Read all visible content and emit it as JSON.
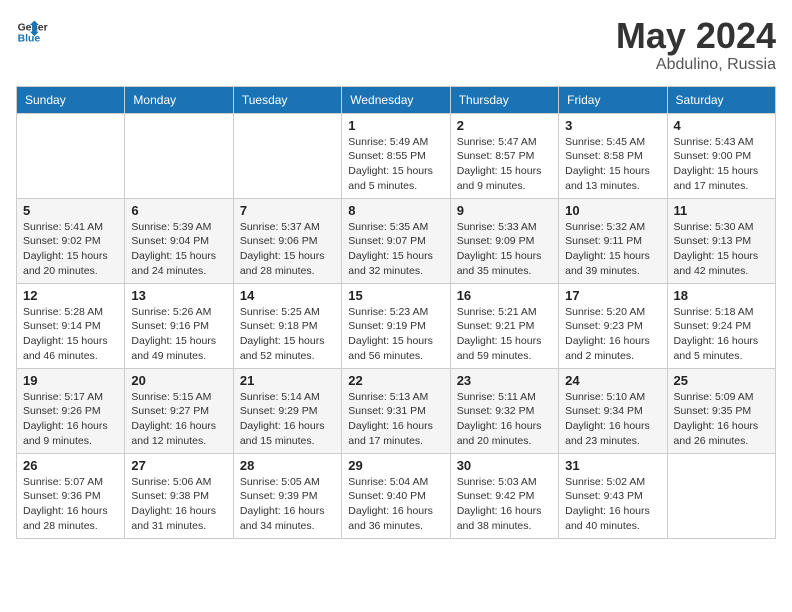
{
  "header": {
    "logo_line1": "General",
    "logo_line2": "Blue",
    "title": "May 2024",
    "location": "Abdulino, Russia"
  },
  "weekdays": [
    "Sunday",
    "Monday",
    "Tuesday",
    "Wednesday",
    "Thursday",
    "Friday",
    "Saturday"
  ],
  "weeks": [
    [
      {
        "day": "",
        "info": ""
      },
      {
        "day": "",
        "info": ""
      },
      {
        "day": "",
        "info": ""
      },
      {
        "day": "1",
        "info": "Sunrise: 5:49 AM\nSunset: 8:55 PM\nDaylight: 15 hours\nand 5 minutes."
      },
      {
        "day": "2",
        "info": "Sunrise: 5:47 AM\nSunset: 8:57 PM\nDaylight: 15 hours\nand 9 minutes."
      },
      {
        "day": "3",
        "info": "Sunrise: 5:45 AM\nSunset: 8:58 PM\nDaylight: 15 hours\nand 13 minutes."
      },
      {
        "day": "4",
        "info": "Sunrise: 5:43 AM\nSunset: 9:00 PM\nDaylight: 15 hours\nand 17 minutes."
      }
    ],
    [
      {
        "day": "5",
        "info": "Sunrise: 5:41 AM\nSunset: 9:02 PM\nDaylight: 15 hours\nand 20 minutes."
      },
      {
        "day": "6",
        "info": "Sunrise: 5:39 AM\nSunset: 9:04 PM\nDaylight: 15 hours\nand 24 minutes."
      },
      {
        "day": "7",
        "info": "Sunrise: 5:37 AM\nSunset: 9:06 PM\nDaylight: 15 hours\nand 28 minutes."
      },
      {
        "day": "8",
        "info": "Sunrise: 5:35 AM\nSunset: 9:07 PM\nDaylight: 15 hours\nand 32 minutes."
      },
      {
        "day": "9",
        "info": "Sunrise: 5:33 AM\nSunset: 9:09 PM\nDaylight: 15 hours\nand 35 minutes."
      },
      {
        "day": "10",
        "info": "Sunrise: 5:32 AM\nSunset: 9:11 PM\nDaylight: 15 hours\nand 39 minutes."
      },
      {
        "day": "11",
        "info": "Sunrise: 5:30 AM\nSunset: 9:13 PM\nDaylight: 15 hours\nand 42 minutes."
      }
    ],
    [
      {
        "day": "12",
        "info": "Sunrise: 5:28 AM\nSunset: 9:14 PM\nDaylight: 15 hours\nand 46 minutes."
      },
      {
        "day": "13",
        "info": "Sunrise: 5:26 AM\nSunset: 9:16 PM\nDaylight: 15 hours\nand 49 minutes."
      },
      {
        "day": "14",
        "info": "Sunrise: 5:25 AM\nSunset: 9:18 PM\nDaylight: 15 hours\nand 52 minutes."
      },
      {
        "day": "15",
        "info": "Sunrise: 5:23 AM\nSunset: 9:19 PM\nDaylight: 15 hours\nand 56 minutes."
      },
      {
        "day": "16",
        "info": "Sunrise: 5:21 AM\nSunset: 9:21 PM\nDaylight: 15 hours\nand 59 minutes."
      },
      {
        "day": "17",
        "info": "Sunrise: 5:20 AM\nSunset: 9:23 PM\nDaylight: 16 hours\nand 2 minutes."
      },
      {
        "day": "18",
        "info": "Sunrise: 5:18 AM\nSunset: 9:24 PM\nDaylight: 16 hours\nand 5 minutes."
      }
    ],
    [
      {
        "day": "19",
        "info": "Sunrise: 5:17 AM\nSunset: 9:26 PM\nDaylight: 16 hours\nand 9 minutes."
      },
      {
        "day": "20",
        "info": "Sunrise: 5:15 AM\nSunset: 9:27 PM\nDaylight: 16 hours\nand 12 minutes."
      },
      {
        "day": "21",
        "info": "Sunrise: 5:14 AM\nSunset: 9:29 PM\nDaylight: 16 hours\nand 15 minutes."
      },
      {
        "day": "22",
        "info": "Sunrise: 5:13 AM\nSunset: 9:31 PM\nDaylight: 16 hours\nand 17 minutes."
      },
      {
        "day": "23",
        "info": "Sunrise: 5:11 AM\nSunset: 9:32 PM\nDaylight: 16 hours\nand 20 minutes."
      },
      {
        "day": "24",
        "info": "Sunrise: 5:10 AM\nSunset: 9:34 PM\nDaylight: 16 hours\nand 23 minutes."
      },
      {
        "day": "25",
        "info": "Sunrise: 5:09 AM\nSunset: 9:35 PM\nDaylight: 16 hours\nand 26 minutes."
      }
    ],
    [
      {
        "day": "26",
        "info": "Sunrise: 5:07 AM\nSunset: 9:36 PM\nDaylight: 16 hours\nand 28 minutes."
      },
      {
        "day": "27",
        "info": "Sunrise: 5:06 AM\nSunset: 9:38 PM\nDaylight: 16 hours\nand 31 minutes."
      },
      {
        "day": "28",
        "info": "Sunrise: 5:05 AM\nSunset: 9:39 PM\nDaylight: 16 hours\nand 34 minutes."
      },
      {
        "day": "29",
        "info": "Sunrise: 5:04 AM\nSunset: 9:40 PM\nDaylight: 16 hours\nand 36 minutes."
      },
      {
        "day": "30",
        "info": "Sunrise: 5:03 AM\nSunset: 9:42 PM\nDaylight: 16 hours\nand 38 minutes."
      },
      {
        "day": "31",
        "info": "Sunrise: 5:02 AM\nSunset: 9:43 PM\nDaylight: 16 hours\nand 40 minutes."
      },
      {
        "day": "",
        "info": ""
      }
    ]
  ]
}
